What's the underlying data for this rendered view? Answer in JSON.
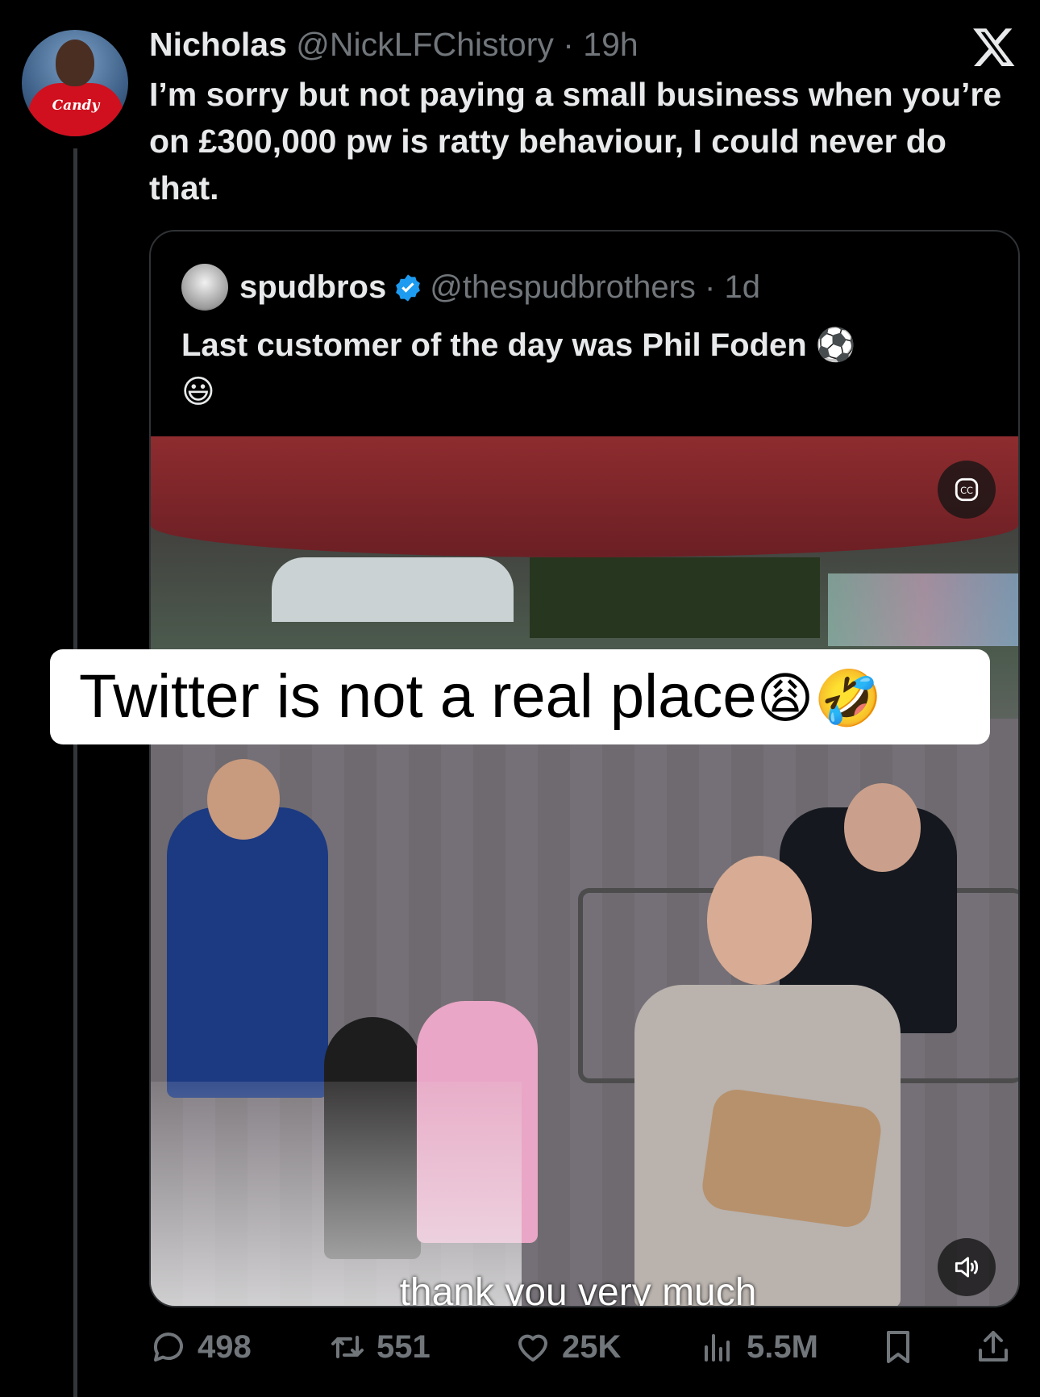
{
  "tweet": {
    "display_name": "Nicholas",
    "handle": "@NickLFChistory",
    "separator": " · ",
    "time": "19h",
    "text": "I’m sorry but not paying a small business when you’re on £300,000 pw is ratty behaviour, I could never do that.",
    "avatar_sponsor": "Candy"
  },
  "quote": {
    "display_name": "spudbros",
    "handle": "@thespudbrothers",
    "separator": " · ",
    "time": "1d",
    "text": "Last customer of the day was Phil Foden",
    "emoji_1": "⚽",
    "emoji_2": "😃",
    "video_caption": "thank you very much"
  },
  "overlay": {
    "text": "Twitter is not a real place",
    "emoji": "😩🤣"
  },
  "actions": {
    "replies": "498",
    "reposts": "551",
    "likes": "25K",
    "views": "5.5M"
  },
  "colors": {
    "background": "#000000",
    "text": "#e7e9ea",
    "muted": "#71767b",
    "verified": "#1d9bf0"
  },
  "icons": [
    "x-logo-icon",
    "verified-badge-icon",
    "captions-icon",
    "volume-icon",
    "reply-icon",
    "repost-icon",
    "like-icon",
    "views-icon",
    "bookmark-icon",
    "share-icon"
  ]
}
